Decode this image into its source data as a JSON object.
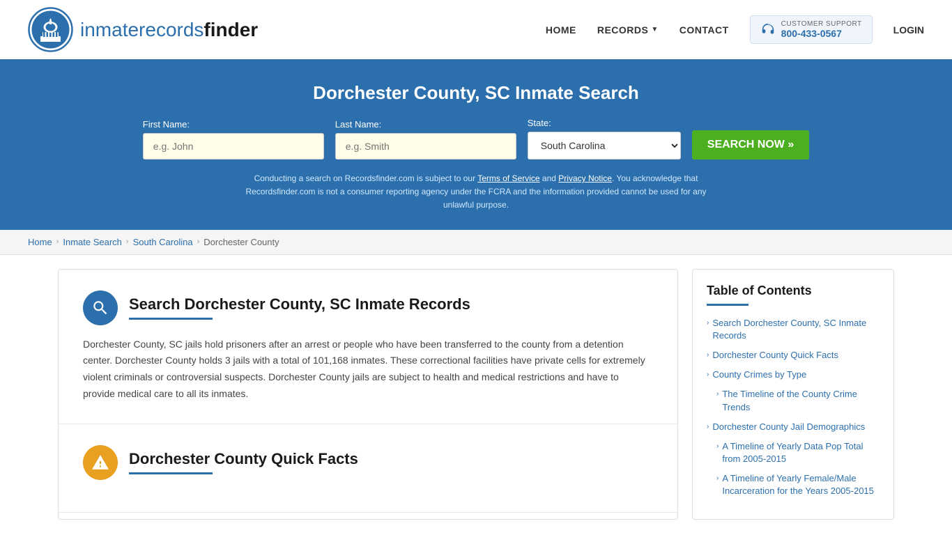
{
  "header": {
    "logo_text_normal": "inmaterecords",
    "logo_text_bold": "finder",
    "nav": {
      "home": "HOME",
      "records": "RECORDS",
      "contact": "CONTACT",
      "login": "LOGIN"
    },
    "support": {
      "label": "CUSTOMER SUPPORT",
      "phone": "800-433-0567"
    }
  },
  "hero": {
    "title": "Dorchester County, SC Inmate Search",
    "form": {
      "first_name_label": "First Name:",
      "first_name_placeholder": "e.g. John",
      "last_name_label": "Last Name:",
      "last_name_placeholder": "e.g. Smith",
      "state_label": "State:",
      "state_value": "South Carolina",
      "search_button": "SEARCH NOW »"
    },
    "disclaimer": "Conducting a search on Recordsfinder.com is subject to our Terms of Service and Privacy Notice. You acknowledge that Recordsfinder.com is not a consumer reporting agency under the FCRA and the information provided cannot be used for any unlawful purpose."
  },
  "breadcrumb": {
    "home": "Home",
    "inmate_search": "Inmate Search",
    "south_carolina": "South Carolina",
    "current": "Dorchester County"
  },
  "main": {
    "section1": {
      "title": "Search Dorchester County, SC Inmate Records",
      "text": "Dorchester County, SC jails hold prisoners after an arrest or people who have been transferred to the county from a detention center. Dorchester County holds 3 jails with a total of 101,168 inmates. These correctional facilities have private cells for extremely violent criminals or controversial suspects. Dorchester County jails are subject to health and medical restrictions and have to provide medical care to all its inmates."
    },
    "section2": {
      "title": "Dorchester County Quick Facts"
    }
  },
  "toc": {
    "title": "Table of Contents",
    "items": [
      {
        "label": "Search Dorchester County, SC Inmate Records",
        "indent": false
      },
      {
        "label": "Dorchester County Quick Facts",
        "indent": false
      },
      {
        "label": "County Crimes by Type",
        "indent": false
      },
      {
        "label": "The Timeline of the County Crime Trends",
        "indent": true
      },
      {
        "label": "Dorchester County Jail Demographics",
        "indent": false
      },
      {
        "label": "A Timeline of Yearly Data Pop Total from 2005-2015",
        "indent": true
      },
      {
        "label": "A Timeline of Yearly Female/Male Incarceration for the Years 2005-2015",
        "indent": true
      }
    ]
  }
}
